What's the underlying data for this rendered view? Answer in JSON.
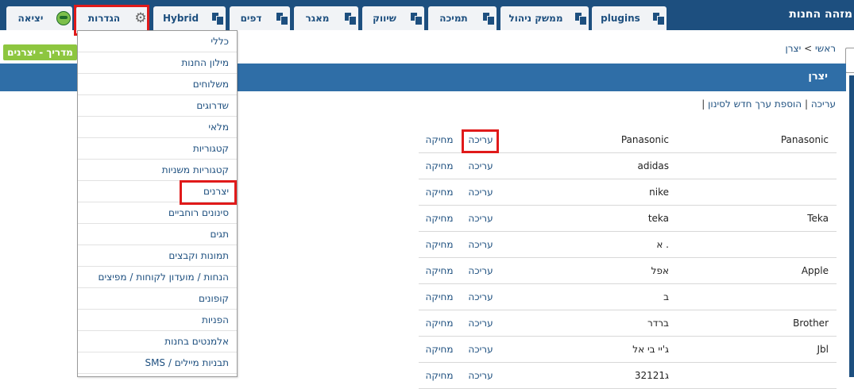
{
  "topbar": {
    "store_title": "מזהה החנות",
    "tabs": [
      {
        "label": "plugins",
        "icon": "documents-icon"
      },
      {
        "label": "ממשק ניהול",
        "icon": "documents-icon"
      },
      {
        "label": "תמיכה",
        "icon": "documents-icon"
      },
      {
        "label": "שיווק",
        "icon": "documents-icon"
      },
      {
        "label": "מאגר",
        "icon": "window-icon"
      },
      {
        "label": "דפים",
        "icon": "documents-icon"
      },
      {
        "label": "Hybrid",
        "icon": "documents-icon"
      },
      {
        "label": "הגדרות",
        "icon": "gear-icon"
      },
      {
        "label": "יציאה",
        "icon": "avatar-icon"
      }
    ]
  },
  "guide_badge": "מדריך - יצרנים",
  "breadcrumb": {
    "home": "ראשי",
    "separator": ">",
    "current": "יצרן"
  },
  "page_title": "יצרן",
  "actions": {
    "edit": "עריכה",
    "sep1": "|",
    "add_filter": "הוספת ערך חדש לסינון",
    "sep2": "|"
  },
  "settings_menu": [
    "כללי",
    "מילון החנות",
    "משלוחים",
    "שדרוגים",
    "מלאי",
    "קטגוריות",
    "קטגוריות משניות",
    "יצרנים",
    "סינונים רוחביים",
    "תגים",
    "תמונות וקבצים",
    "הנחות / מועדון לקוחות / מפיצים",
    "קופונים",
    "הפניות",
    "אלמנטים בחנות",
    "תבניות מיילים / SMS"
  ],
  "manufacturers": {
    "edit_label": "עריכה",
    "delete_label": "מחיקה",
    "rows": [
      {
        "name": "Panasonic",
        "english": "Panasonic"
      },
      {
        "name": "adidas",
        "english": ""
      },
      {
        "name": "nike",
        "english": ""
      },
      {
        "name": "teka",
        "english": "Teka"
      },
      {
        "name": "א .",
        "english": ""
      },
      {
        "name": "אפל",
        "english": "Apple"
      },
      {
        "name": "ב",
        "english": ""
      },
      {
        "name": "ברדר",
        "english": "Brother"
      },
      {
        "name": "ג'יי בי אל",
        "english": "Jbl"
      },
      {
        "name": "32121ג",
        "english": ""
      }
    ]
  },
  "colors": {
    "topbar": "#1d4f7f",
    "page_bar": "#2f6ea7",
    "guide": "#8dc63f",
    "highlight": "#e01a1a"
  }
}
